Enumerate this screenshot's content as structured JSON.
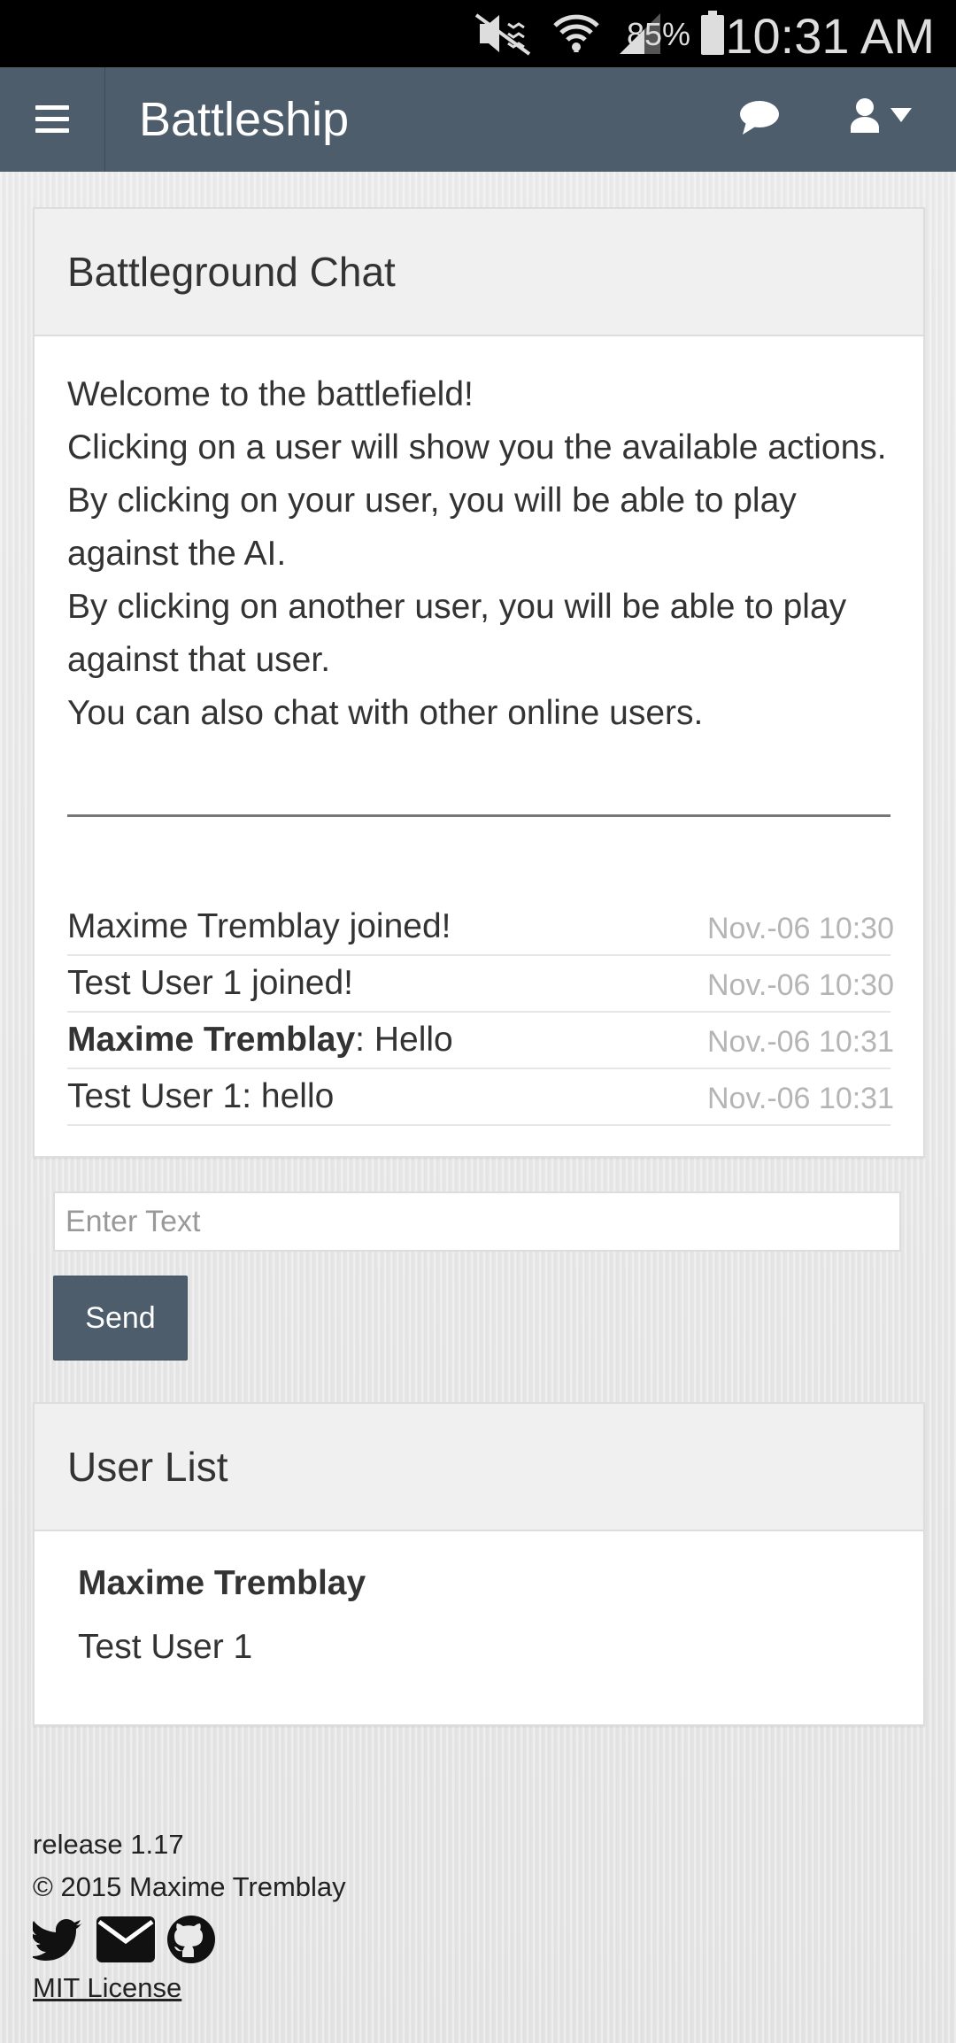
{
  "status_bar": {
    "battery_pct": "85%",
    "time": "10:31 AM",
    "icons": [
      "mute-icon",
      "wifi-icon",
      "signal-icon",
      "battery-icon"
    ]
  },
  "navbar": {
    "title": "Battleship",
    "icons": [
      "hamburger-menu-icon",
      "chat-bubble-icon",
      "user-icon",
      "caret-down-icon"
    ]
  },
  "chat": {
    "heading": "Battleground Chat",
    "intro": [
      "Welcome to the battlefield!",
      "Clicking on a user will show you the available actions.",
      "By clicking on your user, you will be able to play against the AI.",
      "By clicking on another user, you will be able to play against that user.",
      "You can also chat with other online users."
    ],
    "messages": [
      {
        "user": "",
        "text": "Maxime Tremblay joined!",
        "time": "Nov.-06 10:30"
      },
      {
        "user": "",
        "text": "Test User 1 joined!",
        "time": "Nov.-06 10:30"
      },
      {
        "user": "Maxime Tremblay",
        "text": ": Hello",
        "time": "Nov.-06 10:31"
      },
      {
        "user": "",
        "text": "Test User 1: hello",
        "time": "Nov.-06 10:31"
      }
    ],
    "input_placeholder": "Enter Text",
    "input_value": "",
    "send_label": "Send"
  },
  "users": {
    "heading": "User List",
    "list": [
      "Maxime Tremblay",
      "Test User 1"
    ]
  },
  "footer": {
    "release": "release 1.17",
    "copyright": "© 2015 Maxime Tremblay",
    "social_icons": [
      "twitter-icon",
      "email-icon",
      "github-icon"
    ],
    "license": "MIT License"
  },
  "colors": {
    "navbar": "#4e5d6c",
    "panel_heading": "#f0f0f0",
    "timestamp": "#b5b5b5"
  }
}
